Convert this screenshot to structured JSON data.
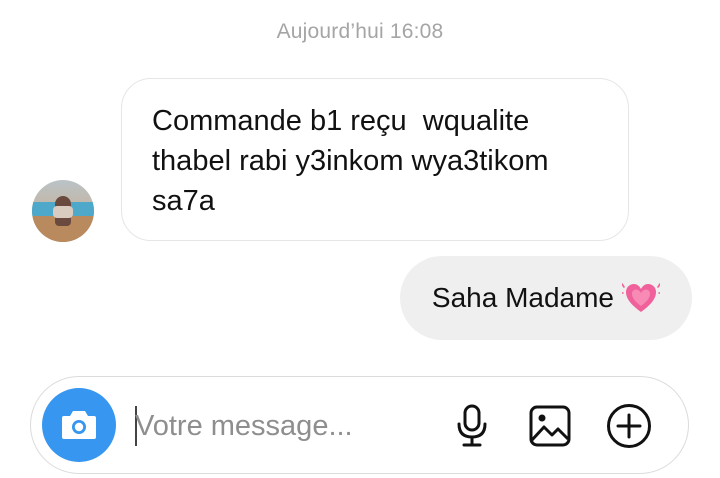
{
  "thread": {
    "timestamp": "Aujourd’hui 16:08"
  },
  "messages": [
    {
      "direction": "incoming",
      "text": "Commande b1 reçu  wqualite thabel rabi y3inkom wya3tikom sa7a"
    },
    {
      "direction": "outgoing",
      "text": "Saha Madame",
      "emoji": "growing-heart-icon"
    }
  ],
  "composer": {
    "placeholder": "Votre message...",
    "value": "",
    "icons": [
      "camera-icon",
      "microphone-icon",
      "gallery-icon",
      "plus-circle-icon"
    ]
  },
  "colors": {
    "accent": "#3797f0",
    "incoming_bubble_border": "#e6e6e6",
    "outgoing_bubble_bg": "#efefef",
    "timestamp_text": "#a5a5a5",
    "heart": "#f0609a"
  }
}
